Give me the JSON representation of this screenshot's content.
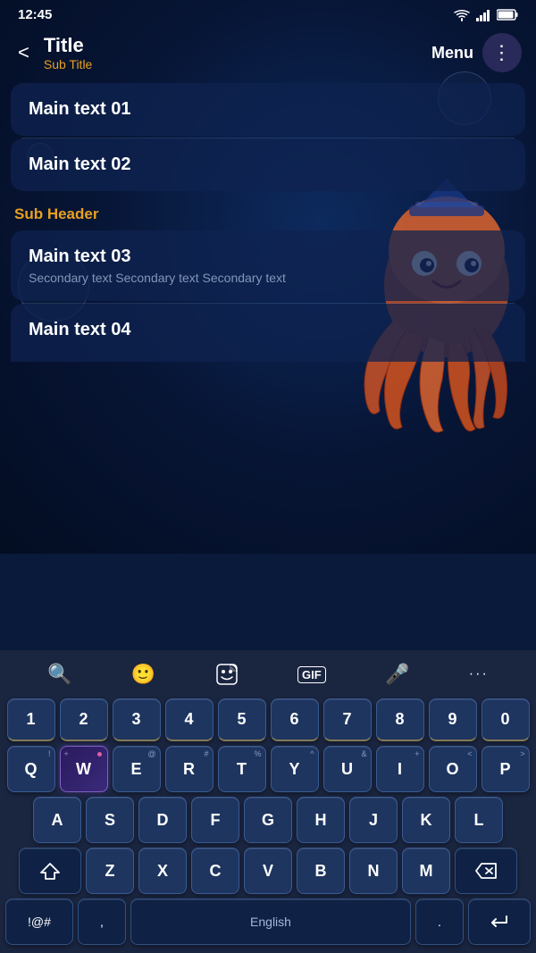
{
  "statusBar": {
    "time": "12:45",
    "wifi": "wifi",
    "signal": "signal",
    "battery": "battery"
  },
  "header": {
    "title": "Title",
    "subtitle": "Sub Title",
    "backLabel": "<",
    "menuLabel": "Menu",
    "dotsLabel": "⋮"
  },
  "list": {
    "items": [
      {
        "id": 1,
        "title": "Main text 01",
        "secondary": ""
      },
      {
        "id": 2,
        "title": "Main text 02",
        "secondary": ""
      },
      {
        "id": 3,
        "title": "Main text 03",
        "secondary": "Secondary text Secondary text Secondary text"
      },
      {
        "id": 4,
        "title": "Main text 04",
        "secondary": ""
      }
    ],
    "subHeader": "Sub Header"
  },
  "keyboard": {
    "toolbar": {
      "search": "🔍",
      "emoji": "😊",
      "sticker": "sticker",
      "gif": "GIF",
      "mic": "🎤",
      "more": "···"
    },
    "rows": {
      "numbers": [
        "1",
        "2",
        "3",
        "4",
        "5",
        "6",
        "7",
        "8",
        "9",
        "0"
      ],
      "qwerty": [
        "Q",
        "W",
        "E",
        "R",
        "T",
        "Y",
        "U",
        "I",
        "O",
        "P"
      ],
      "asdf": [
        "A",
        "S",
        "D",
        "F",
        "G",
        "H",
        "J",
        "K",
        "L"
      ],
      "zxcv": [
        "Z",
        "X",
        "C",
        "V",
        "B",
        "N",
        "M"
      ],
      "special": {
        "shift": "⇧",
        "delete": "⌫",
        "numbers": "!@#",
        "comma": ",",
        "space": "English",
        "period": ".",
        "enter": "↵"
      }
    },
    "subLabels": {
      "Q": "!",
      "W": "+",
      "E": "@",
      "R": "#",
      "T": "%",
      "Y": "^",
      "U": "&",
      "I": "+",
      "O": "<",
      "P": ">",
      "A": "",
      "S": "",
      "D": "",
      "F": "",
      "G": "",
      "H": "",
      "J": "",
      "K": "",
      "L": ""
    }
  }
}
